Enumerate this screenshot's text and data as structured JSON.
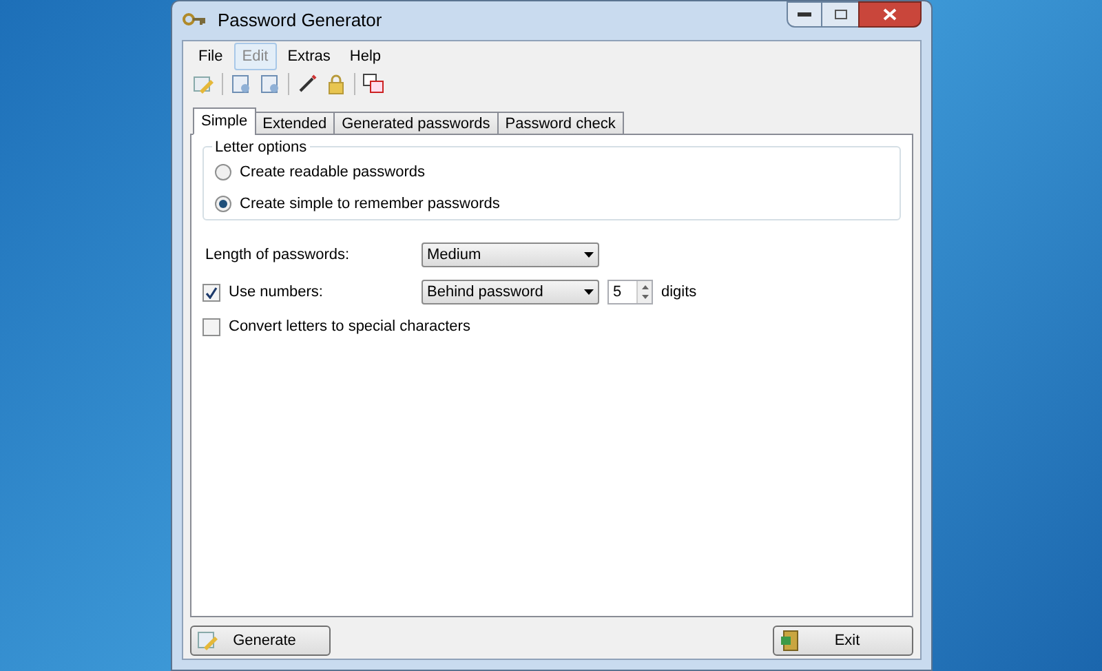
{
  "window": {
    "title": "Password Generator"
  },
  "menu": [
    {
      "label": "File",
      "selected": false
    },
    {
      "label": "Edit",
      "selected": true
    },
    {
      "label": "Extras",
      "selected": false
    },
    {
      "label": "Help",
      "selected": false
    }
  ],
  "tabs": [
    {
      "label": "Simple",
      "selected": true
    },
    {
      "label": "Extended",
      "selected": false
    },
    {
      "label": "Generated passwords",
      "selected": false
    },
    {
      "label": "Password check",
      "selected": false
    }
  ],
  "letter_options": {
    "title": "Letter options",
    "options": [
      {
        "label": "Create readable passwords",
        "selected": false
      },
      {
        "label": "Create simple to remember passwords",
        "selected": true
      }
    ]
  },
  "length": {
    "label": "Length of passwords:",
    "value": "Medium"
  },
  "numbers": {
    "label": "Use numbers:",
    "checked": true,
    "position": "Behind password",
    "count": "5",
    "unit": "digits"
  },
  "special": {
    "label": "Convert letters to special characters",
    "checked": false
  },
  "buttons": [
    {
      "label": "Generate",
      "kind": "generate"
    },
    {
      "label": "Exit",
      "kind": "exit"
    }
  ]
}
